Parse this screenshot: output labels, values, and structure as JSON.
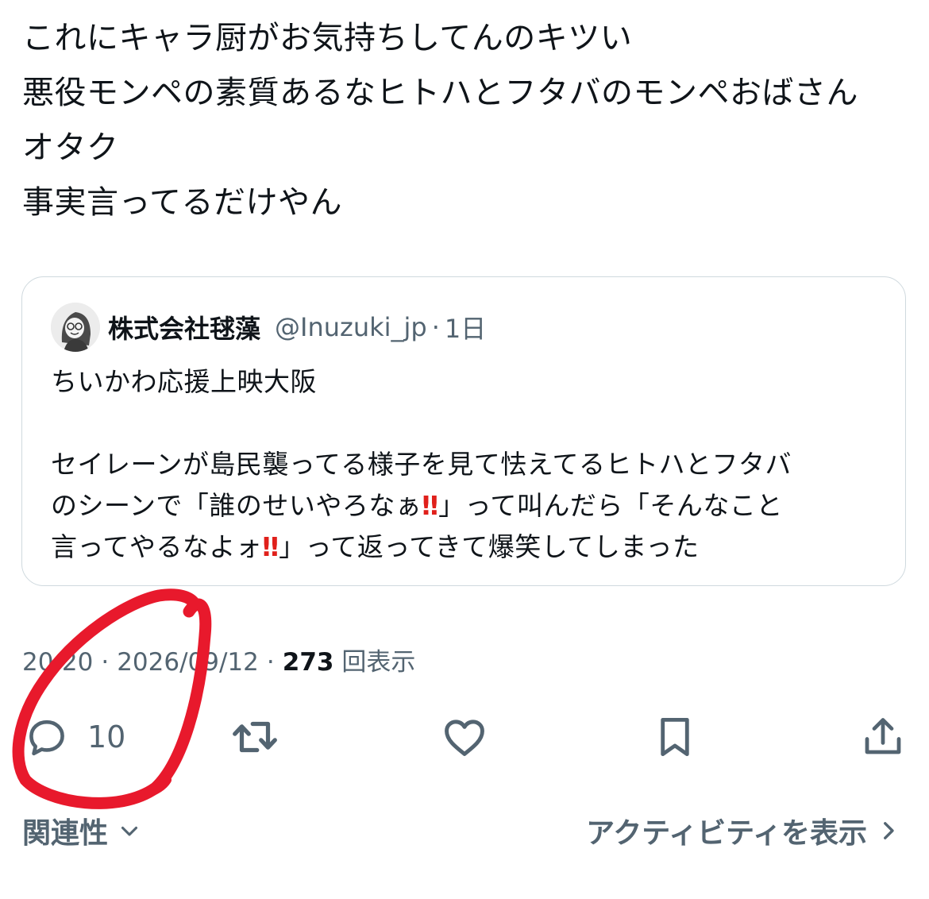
{
  "tweet": {
    "lines": [
      "これにキャラ厨がお気持ちしてんのキツい",
      "悪役モンペの素質あるなヒトハとフタバのモンペおばさん",
      "オタク",
      "事実言ってるだけやん"
    ]
  },
  "quote": {
    "display_name": "株式会社毬藻",
    "handle": "@Inuzuki_jp",
    "separator": "·",
    "time": "1日",
    "line1": "ちいかわ応援上映大阪",
    "line3": "セイレーンが島民襲ってる様子を見て怯えてるヒトハとフタバ",
    "line4_a": "のシーンで「誰のせいやろなぁ",
    "line4_emoji": "‼",
    "line4_b": "」って叫んだら「そんなこと",
    "line5_a": "言ってやるなよォ",
    "line5_emoji": "‼",
    "line5_b": "」って返ってきて爆笑してしまった"
  },
  "meta": {
    "time": "20:20",
    "separator": "·",
    "date": "2026/09/12",
    "views_count": "273",
    "views_label": "回表示"
  },
  "actions": {
    "reply_count": "10",
    "reply_icon": "reply-icon",
    "retweet_icon": "retweet-icon",
    "like_icon": "heart-icon",
    "bookmark_icon": "bookmark-icon",
    "share_icon": "share-icon"
  },
  "footer": {
    "sort_label": "関連性",
    "activity_label": "アクティビティを表示"
  },
  "colors": {
    "text": "#0f1419",
    "secondary": "#536471",
    "border": "#cfd9de",
    "annotation_red": "#e8192c",
    "emoji_red": "#e0201b"
  }
}
